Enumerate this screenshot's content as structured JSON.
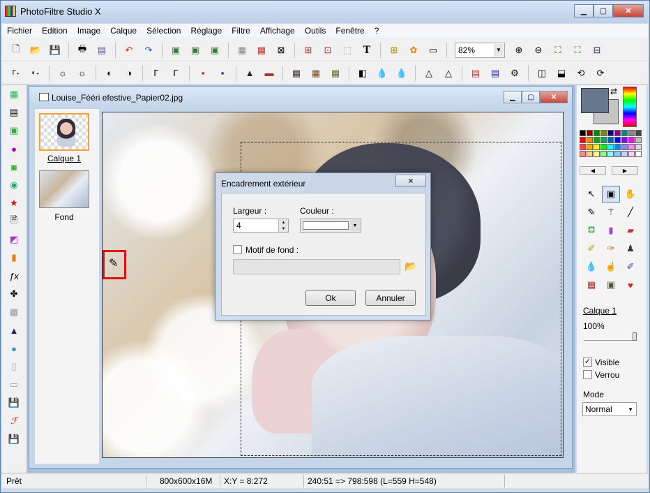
{
  "app": {
    "title": "PhotoFiltre Studio X"
  },
  "menu": [
    "Fichier",
    "Edition",
    "Image",
    "Calque",
    "Sélection",
    "Réglage",
    "Filtre",
    "Affichage",
    "Outils",
    "Fenêtre",
    "?"
  ],
  "toolbar": {
    "zoom": "82%",
    "text_tool_label": "T"
  },
  "document": {
    "title": "Louise_Fééri efestive_Papier02.jpg",
    "layers": [
      {
        "label": "Calque 1"
      },
      {
        "label": "Fond"
      }
    ]
  },
  "dialog": {
    "title": "Encadrement extérieur",
    "close_label": "×",
    "width_label": "Largeur :",
    "width_value": "4",
    "color_label": "Couleur :",
    "pattern_label": "Motif de fond :",
    "ok_label": "Ok",
    "cancel_label": "Annuler"
  },
  "right_panel": {
    "layer_name": "Calque 1",
    "opacity": "100%",
    "visible_label": "Visible",
    "lock_label": "Verrou",
    "mode_label": "Mode",
    "mode_value": "Normal",
    "colors": {
      "foreground": "#67788e",
      "background": "#c5c5c5"
    }
  },
  "statusbar": {
    "state": "Prêt",
    "size": "800x600x16M",
    "coords": "X:Y = 8:272",
    "selection": "240:51 => 798:598 (L=559  H=548)"
  }
}
